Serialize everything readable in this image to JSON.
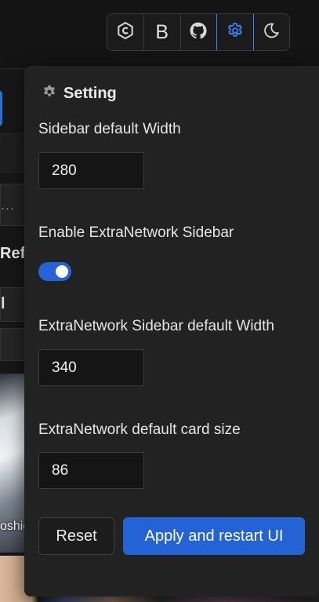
{
  "toolbar": {
    "items": [
      {
        "icon": "civitai-icon"
      },
      {
        "icon": "bold-b-icon",
        "label": "B"
      },
      {
        "icon": "github-icon"
      },
      {
        "icon": "gear-icon",
        "active": true
      },
      {
        "icon": "moon-icon"
      }
    ],
    "accent": "#3b82f6"
  },
  "background": {
    "refresh_fragment": "Refr",
    "box_fragment": "l",
    "input_fragment": "...",
    "card_caption_fragment": "oshic"
  },
  "settings": {
    "title": "Setting",
    "sidebar_width_label": "Sidebar default Width",
    "sidebar_width_value": "280",
    "enable_extra_label": "Enable ExtraNetwork Sidebar",
    "enable_extra_on": true,
    "extra_width_label": "ExtraNetwork Sidebar default Width",
    "extra_width_value": "340",
    "card_size_label": "ExtraNetwork default card size",
    "card_size_value": "86",
    "reset_label": "Reset",
    "apply_label": "Apply and restart UI",
    "primary_color": "#2463d6",
    "panel_background": "#222222"
  }
}
